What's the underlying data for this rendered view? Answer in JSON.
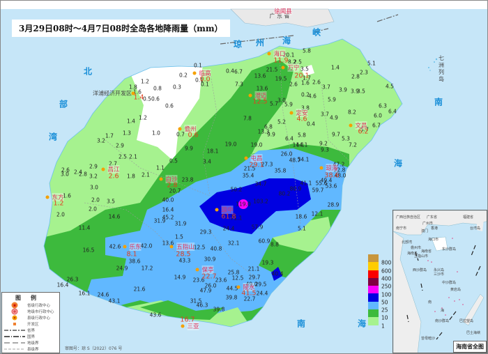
{
  "title": "3月29日08时～4月7日08时全岛各地降雨量（mm）",
  "colors": {
    "sea": "#c6e6f8",
    "r1": "#a6f28f",
    "r10": "#3dba3d",
    "r25": "#61b8ff",
    "r50": "#0000e1",
    "r100": "#fa00fa",
    "r250": "#800040",
    "r400": "#fa0000",
    "r600": "#ffcc00",
    "r800": "#c8963c"
  },
  "scale": {
    "labels": [
      "800",
      "600",
      "400",
      "250",
      "100",
      "50",
      "25",
      "10",
      "1"
    ]
  },
  "sea_labels": {
    "qiongzhou": [
      "琼",
      "州",
      "海",
      "峡"
    ],
    "beibu": [
      "北",
      "部",
      "湾"
    ],
    "nanhai": [
      "南",
      "海"
    ],
    "south_sea_bottom": [
      "南",
      "海"
    ]
  },
  "land_labels": {
    "guangdong": "广 东 省",
    "xuwen": "徐闻县",
    "qizhou": "七洲列岛",
    "yangpu": "洋浦经济开发区"
  },
  "cities": [
    {
      "name": "海口",
      "rain": "11.9"
    },
    {
      "name": "临高",
      "rain": "0.0"
    },
    {
      "name": "澄迈",
      "rain": "12.5"
    },
    {
      "name": "定安",
      "rain": "4.6"
    },
    {
      "name": "文昌",
      "rain": "6.2"
    },
    {
      "name": "儋州",
      "rain": "0.6"
    },
    {
      "name": "屯昌",
      "rain": "29.1"
    },
    {
      "name": "琼海",
      "rain": "38.6"
    },
    {
      "name": "昌江",
      "rain": "2.6"
    },
    {
      "name": "白沙",
      "rain": "2.8"
    },
    {
      "name": "琼中",
      "rain": "61.8"
    },
    {
      "name": "东方",
      "rain": "1.2"
    },
    {
      "name": "乐东",
      "rain": "8.1"
    },
    {
      "name": "五指山",
      "rain": "28.5"
    },
    {
      "name": "保亭",
      "rain": "22.7"
    },
    {
      "name": "万宁",
      "rain": "20.1"
    },
    {
      "name": "陵水",
      "rain": "41.5"
    },
    {
      "name": "三亚",
      "rain": "16.7"
    }
  ],
  "yangpu_rain": "1.4",
  "values": [
    "5.8",
    "20.1",
    "8.2",
    "2.5",
    "3.5",
    "0.4",
    "6.7",
    "21.5",
    "13.6",
    "19.5",
    "2.6",
    "1.6",
    "2.6",
    "1.7",
    "3.7",
    "7.3",
    "13.6",
    "0.1",
    "0.1",
    "0.1",
    "0.2",
    "0.3",
    "1.4",
    "19.0",
    "18.1",
    "14.1",
    "9.2",
    "9.3",
    "3.4",
    "27.3",
    "26.0",
    "48.7",
    "54.1",
    "21.5",
    "35.8",
    "35.4",
    "47.2",
    "22.8",
    "48.0",
    "34.7",
    "50.2",
    "41.1",
    "55.6",
    "49.4",
    "53.6",
    "80.9",
    "59.7",
    "80.2",
    "119.0",
    "103.2",
    "71.1",
    "28.9",
    "18.6",
    "12.1",
    "57.9",
    "5.1",
    "24.4",
    "40.0",
    "1.4",
    "1.2",
    "1.0",
    "0.7",
    "1.7",
    "1.3",
    "3.2",
    "2.9",
    "2.5",
    "2.1",
    "9.9",
    "0.5",
    "2.7",
    "2.9",
    "1.1",
    "2.6",
    "3.0",
    "2.4",
    "2.8",
    "3.2",
    "1.8",
    "2.1",
    "23.8",
    "3.0",
    "20.7",
    "1.6",
    "2.0",
    "3.5",
    "2.0",
    "2.0",
    "42.6",
    "42.0",
    "13.6",
    "1.5",
    "12.5",
    "40.8",
    "32.1",
    "60.9",
    "8.8",
    "38.6",
    "43.3",
    "30.9",
    "24.9",
    "17.2",
    "21.1",
    "19.3",
    "25.8",
    "14.9",
    "23.6",
    "23.6",
    "12.5",
    "29.7",
    "40.4",
    "26.0",
    "44.5",
    "49.0",
    "29.5",
    "47.9",
    "21.6",
    "24.4",
    "43.1",
    "39.8",
    "22.7",
    "31.5",
    "46.3",
    "39.8",
    "43.6",
    "3.9",
    "3.9",
    "3.5",
    "4.5",
    "0.2",
    "4.6",
    "3.0",
    "5.7",
    "5.9",
    "5.9",
    "3.8",
    "6.3",
    "6.4",
    "8.2",
    "6.0",
    "7.8",
    "3.7",
    "4.9",
    "5.2",
    "0.4",
    "6.7",
    "5.7",
    "6.8",
    "13.3",
    "9.9",
    "9.7",
    "5.3",
    "5.8",
    "6.4",
    "7.2",
    "19.0",
    "14.1",
    "5.1",
    "2.8",
    "2.3",
    "1.2",
    "1.8",
    "1.6",
    "0.8",
    "0.5",
    "0.6",
    "0.6",
    "11.4",
    "14.6",
    "31.9",
    "45.2",
    "16.5",
    "26.3",
    "16.4",
    "16.1",
    "24.6",
    "29.3",
    "31.9",
    "16.4"
  ],
  "legend": {
    "title": "图例",
    "items": [
      "省级行政中心",
      "地级市行政中心",
      "县级行政中心",
      "开发区",
      "省界",
      "国界",
      "地级界",
      "县级界"
    ]
  },
  "approval": "审图号：琼 S（2022）076 号",
  "inset": {
    "title": "海南省全图",
    "labels": [
      "广西壮族自治区",
      "广东省",
      "福建省",
      "南宁市",
      "广州市",
      "澳门",
      "香港",
      "台湾岛",
      "北部湾",
      "海口市",
      "海南省",
      "儋州市",
      "五指山市",
      "海南岛",
      "东沙群岛",
      "西沙群岛",
      "永兴岛",
      "三沙市",
      "中沙群岛",
      "黄岩岛",
      "南",
      "海",
      "南沙群岛",
      "巴士海峡",
      "苏禄海",
      "曾母暗沙",
      "巴拉望岛"
    ]
  }
}
